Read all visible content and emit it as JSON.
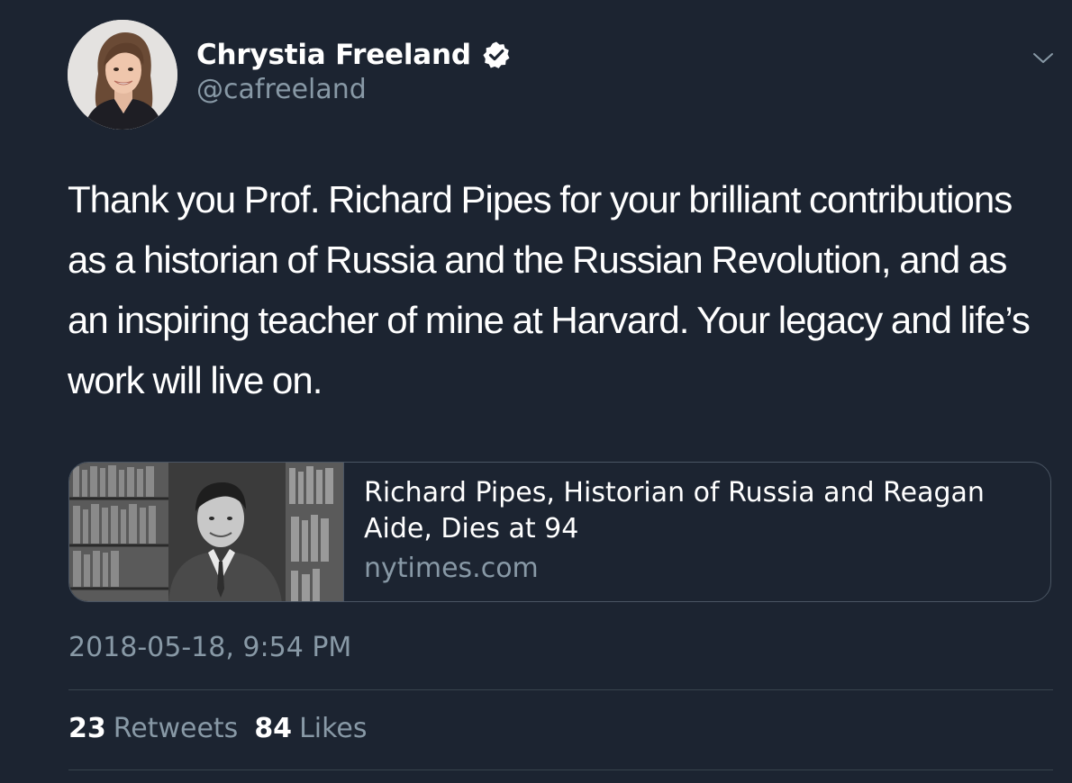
{
  "tweet": {
    "author": {
      "display_name": "Chrystia Freeland",
      "handle": "@cafreeland",
      "verified": true,
      "avatar_icon": "profile-photo"
    },
    "text": "Thank you Prof. Richard Pipes for your brilliant contributions as a historian of Russia and the Russian Revolution, and as an inspiring teacher of mine at Harvard. Your legacy and life’s work will live on.",
    "menu_icon": "chevron-down-icon",
    "card": {
      "title": "Richard Pipes, Historian of Russia and Reagan Aide, Dies at 94",
      "domain": "nytimes.com",
      "image_icon": "article-thumbnail"
    },
    "timestamp": "2018-05-18, 9:54 PM",
    "stats": {
      "retweets_count": "23",
      "retweets_label": "Retweets",
      "likes_count": "84",
      "likes_label": "Likes"
    }
  },
  "colors": {
    "background": "#1c2431",
    "text_primary": "#ffffff",
    "text_secondary": "#8899a6",
    "border": "#38444d"
  }
}
